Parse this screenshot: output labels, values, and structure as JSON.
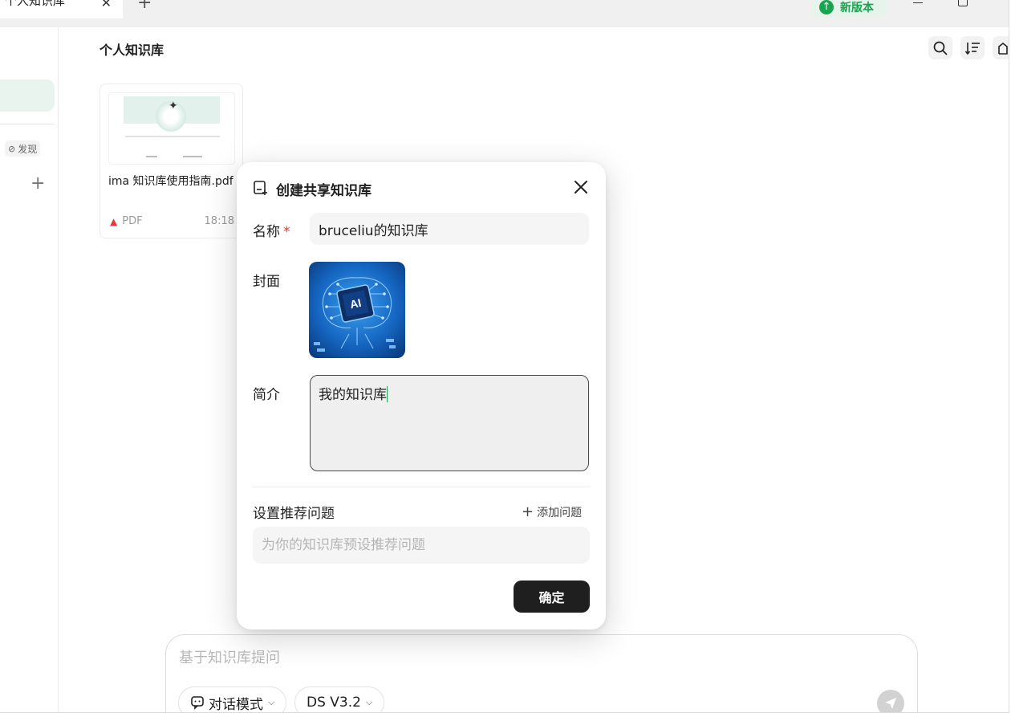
{
  "tabs": [
    {
      "label": "个人知识库"
    }
  ],
  "titlebar": {
    "new_version_label": "新版本"
  },
  "sidebar": {
    "discover_label": "发现"
  },
  "main": {
    "title": "个人知识库"
  },
  "file_card": {
    "name": "ima 知识库使用指南.pdf",
    "type": "PDF",
    "time": "18:18"
  },
  "chat": {
    "placeholder": "基于知识库提问",
    "mode_label": "对话模式",
    "model_label": "DS V3.2"
  },
  "modal": {
    "title": "创建共享知识库",
    "name_label": "名称",
    "required_mark": "*",
    "name_value": "bruceliu的知识库",
    "cover_label": "封面",
    "desc_label": "简介",
    "desc_value": "我的知识库",
    "rec_title": "设置推荐问题",
    "add_question_label": "添加问题",
    "question_placeholder": "为你的知识库预设推荐问题",
    "confirm_label": "确定"
  },
  "colors": {
    "accent": "#1aa350",
    "dark": "#1f1f1f",
    "required": "#e0352b",
    "cover_blue": "#1565c0"
  }
}
